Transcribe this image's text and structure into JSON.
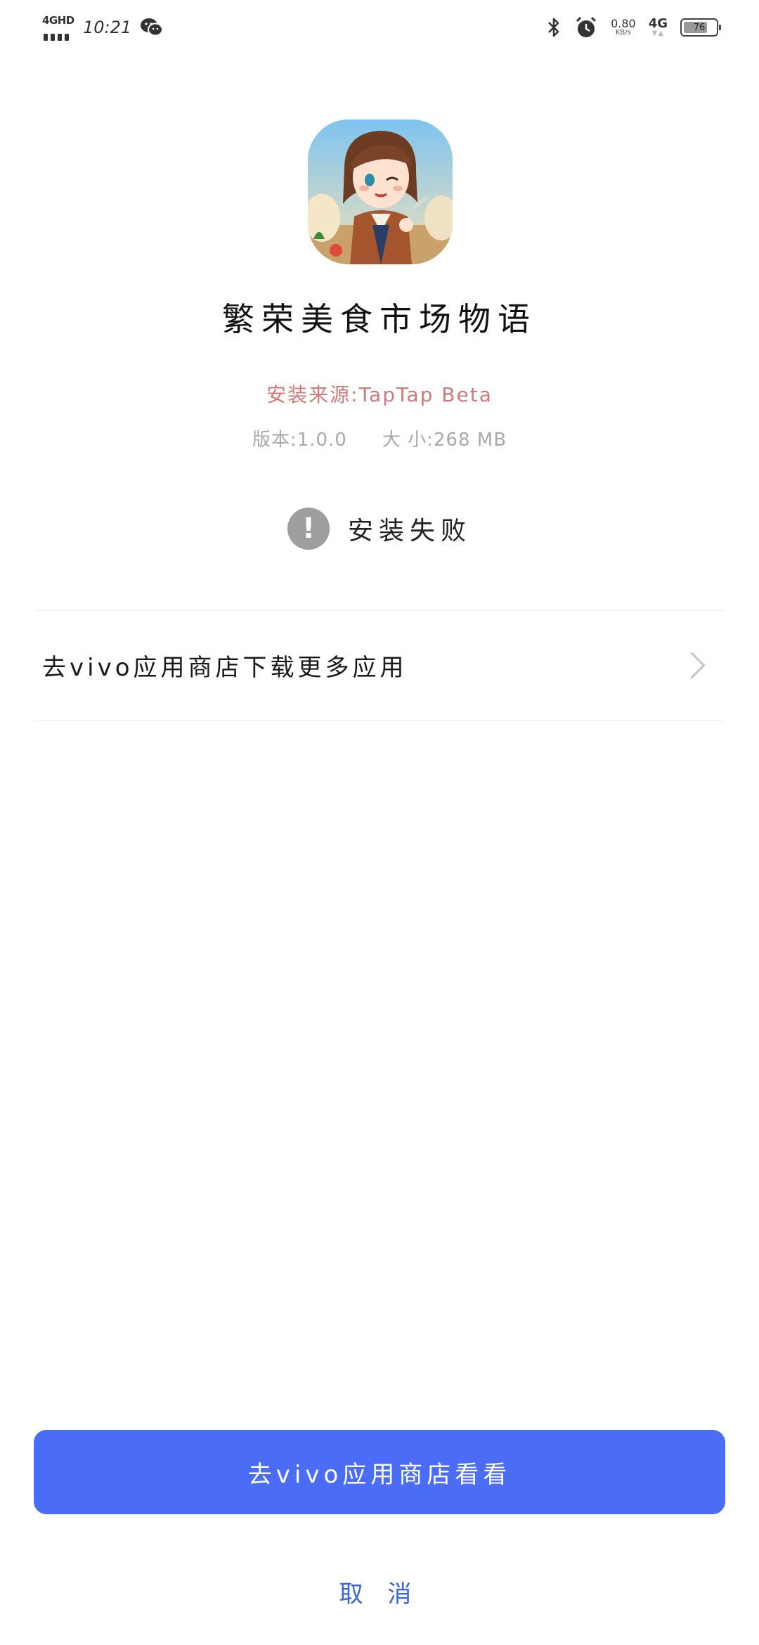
{
  "status_bar": {
    "network_label": "4GHD",
    "time": "10:21",
    "net_speed_value": "0.80",
    "net_speed_unit": "KB/s",
    "cellular_label": "4G",
    "battery_level": "76",
    "battery_fraction": 0.76,
    "icons": [
      "signal-icon",
      "wechat-icon",
      "bluetooth-icon",
      "alarm-icon"
    ]
  },
  "app": {
    "icon": "game-avatar-icon",
    "name": "繁荣美食市场物语",
    "source": "安装来源:TapTap Beta",
    "version": "版本:1.0.0",
    "size": "大 小:268 MB"
  },
  "install_status": {
    "icon": "warning-icon",
    "glyph": "!",
    "text": "安装失败"
  },
  "store_link": {
    "label": "去vivo应用商店下载更多应用",
    "icon": "chevron-right-icon"
  },
  "actions": {
    "primary_label": "去vivo应用商店看看",
    "cancel_label": "取 消"
  },
  "colors": {
    "source_text": "#d07a7a",
    "primary_button": "#4a6cf7",
    "cancel_text": "#3c64d6"
  }
}
